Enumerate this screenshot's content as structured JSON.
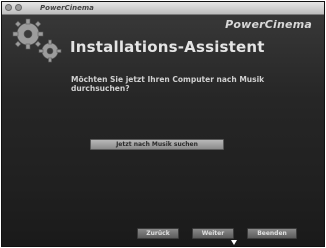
{
  "window": {
    "app_title": "PowerCinema",
    "brand": "PowerCinema"
  },
  "icons": {
    "logo": "gears-icon",
    "window_controls": [
      "window-button-icon",
      "window-button-icon"
    ],
    "cursor": "mouse-cursor-icon"
  },
  "wizard": {
    "heading": "Installations-Assistent",
    "question": "Möchten Sie jetzt Ihren Computer nach Musik durchsuchen?",
    "search_button": "Jetzt nach Musik suchen"
  },
  "footer": {
    "back_label": "Zurück",
    "next_label": "Weiter",
    "finish_label": "Beenden"
  },
  "colors": {
    "background": "#262626",
    "text": "#e4e4e4",
    "button": "#8c8c8c"
  }
}
